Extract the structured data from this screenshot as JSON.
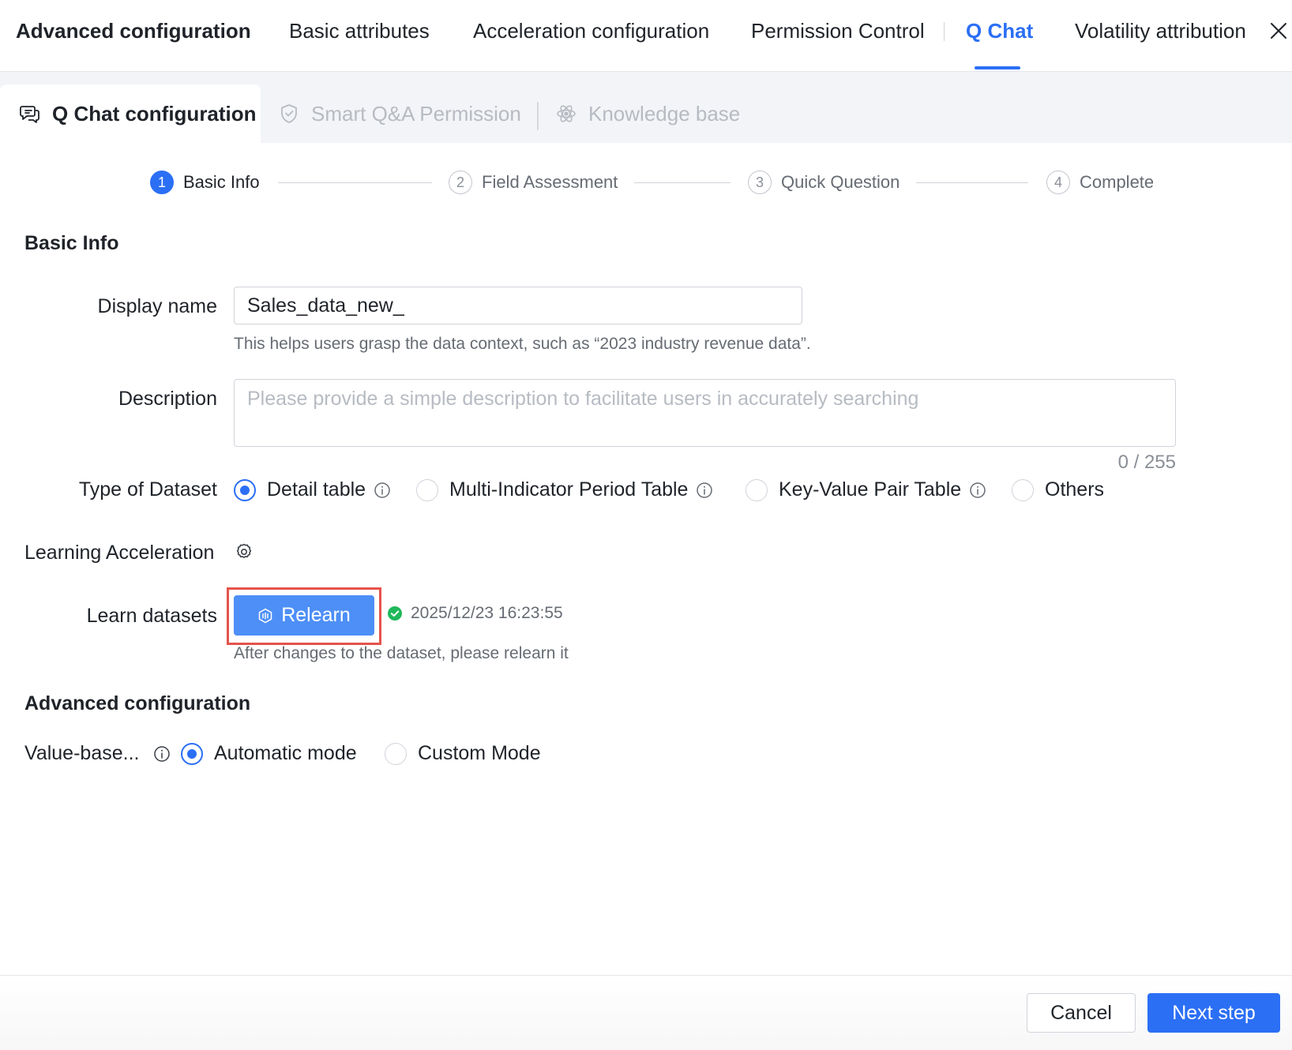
{
  "header": {
    "title": "Advanced configuration",
    "tabs": [
      {
        "label": "Basic attributes"
      },
      {
        "label": "Acceleration configuration"
      },
      {
        "label": "Permission Control"
      },
      {
        "label": "Q Chat"
      },
      {
        "label": "Volatility attribution"
      }
    ],
    "active_tab": "Q Chat",
    "close_icon": "close-icon"
  },
  "subtabs": [
    {
      "label": "Q Chat configuration",
      "icon": "chat-icon",
      "state": "active"
    },
    {
      "label": "Smart Q&A Permission",
      "icon": "shield-icon",
      "state": "disabled"
    },
    {
      "label": "Knowledge base",
      "icon": "atom-icon",
      "state": "disabled"
    }
  ],
  "steps": [
    {
      "num": "1",
      "label": "Basic Info",
      "state": "active"
    },
    {
      "num": "2",
      "label": "Field Assessment",
      "state": "pending"
    },
    {
      "num": "3",
      "label": "Quick Question",
      "state": "pending"
    },
    {
      "num": "4",
      "label": "Complete",
      "state": "pending"
    }
  ],
  "form": {
    "section_basic": "Basic Info",
    "display_name": {
      "label": "Display name",
      "value": "Sales_data_new_",
      "help": "This helps users grasp the data context, such as “2023 industry revenue data”."
    },
    "description": {
      "label": "Description",
      "value": "",
      "placeholder": "Please provide a simple description to facilitate users in accurately searching",
      "counter": "0 / 255"
    },
    "dataset_type": {
      "label": "Type of Dataset",
      "options": [
        {
          "label": "Detail table",
          "checked": true
        },
        {
          "label": "Multi-Indicator Period Table",
          "checked": false
        },
        {
          "label": "Key-Value Pair Table",
          "checked": false
        },
        {
          "label": "Others",
          "checked": false
        }
      ]
    },
    "learning_acceleration": {
      "label": "Learning Acceleration"
    },
    "learn_datasets": {
      "label": "Learn datasets",
      "button_label": "Relearn",
      "status_time": "2025/12/23 16:23:55",
      "help": "After changes to the dataset, please relearn it"
    },
    "section_advanced": "Advanced configuration",
    "value_based": {
      "label": "Value-base...",
      "options": [
        {
          "label": "Automatic mode",
          "checked": true
        },
        {
          "label": "Custom Mode",
          "checked": false
        }
      ]
    }
  },
  "footer": {
    "cancel_label": "Cancel",
    "next_label": "Next step"
  },
  "colors": {
    "accent": "#2b6ff5",
    "relearn_button": "#4d8ff7",
    "highlight_box": "#e5534b",
    "success": "#1fb85a",
    "disabled_text": "#b7bbc2"
  }
}
